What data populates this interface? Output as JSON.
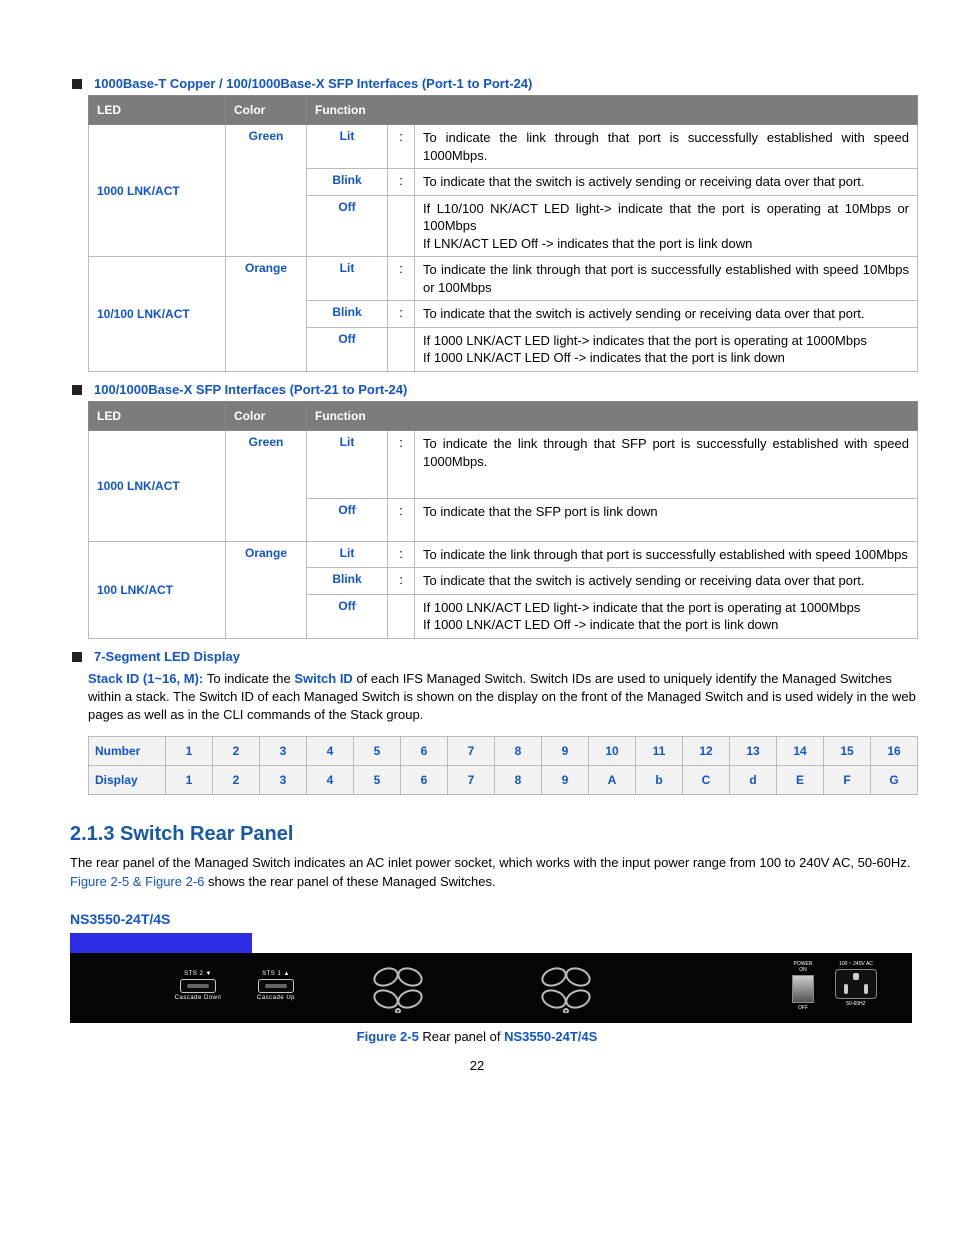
{
  "sections": {
    "led_ports": {
      "bullet": "1000Base-T Copper / 100/1000Base-X SFP Interfaces (Port-1 to Port-24)",
      "header": {
        "c1": "LED",
        "c2": "Color",
        "c3": "Function"
      },
      "row1": {
        "label": "1000 LNK/ACT",
        "color": "Green",
        "r": [
          {
            "state": "Lit",
            "fn": "To indicate the link through that port is successfully established with speed 1000Mbps."
          },
          {
            "state": "Blink",
            "fn": "To indicate that the switch is actively sending or receiving data over that port."
          },
          {
            "state": "Off",
            "fn": "If L10/100 NK/ACT LED light-> indicate that the port is operating at 10Mbps or 100Mbps\nIf LNK/ACT LED Off -> indicates that the port is link down"
          }
        ]
      },
      "row2": {
        "label": "10/100 LNK/ACT",
        "color": "Orange",
        "r": [
          {
            "state": "Lit",
            "fn": "To indicate the link through that port is successfully established with speed 10Mbps or 100Mbps"
          },
          {
            "state": "Blink",
            "fn": "To indicate that the switch is actively sending or receiving data over that port."
          },
          {
            "state": "Off",
            "fn": "If 1000 LNK/ACT LED light-> indicates that the port is operating at 1000Mbps\nIf 1000 LNK/ACT LED Off -> indicates that the port is link down"
          }
        ]
      }
    },
    "led_sfp": {
      "bullet": "100/1000Base-X SFP Interfaces (Port-21 to Port-24)",
      "header": {
        "c1": "LED",
        "c2": "Color",
        "c3": "Function"
      },
      "row1": {
        "label": "1000 LNK/ACT",
        "color": "Green",
        "r": [
          {
            "state": "Lit",
            "fn": "To indicate the link through that SFP port is successfully established with speed 1000Mbps."
          },
          {
            "state": "Off",
            "fn": "To indicate that the SFP port is link down"
          }
        ]
      },
      "row2": {
        "label": "100 LNK/ACT",
        "color": "Orange",
        "r": [
          {
            "state": "Lit",
            "fn": "To indicate the link through that port is successfully established with speed 100Mbps"
          },
          {
            "state": "Blink",
            "fn": "To indicate that the switch is actively sending or receiving data over that port."
          },
          {
            "state": "Off",
            "fn": "If 1000 LNK/ACT LED light-> indicate that the port is operating at 1000Mbps\nIf 1000 LNK/ACT LED Off -> indicate that the port is link down"
          }
        ]
      }
    },
    "stack": {
      "bullet": "7-Segment LED Display",
      "desc": {
        "l1a": "Stack ID (1~16, M): ",
        "l1b": "To indicate the ",
        "l1c": "Switch ID",
        "l1d": " of each IFS Managed Switch. Switch IDs are used to uniquely identify the Managed Switches within a stack. The Switch ID of each Managed Switch is shown on the display on the front of the Managed Switch and is used widely in the web pages as well as in the CLI commands of the Stack group."
      },
      "table": {
        "hdr1": "Number",
        "hdr2": "Display",
        "nums": [
          "1",
          "2",
          "3",
          "4",
          "5",
          "6",
          "7",
          "8",
          "9",
          "10",
          "11",
          "12",
          "13",
          "14",
          "15",
          "16"
        ],
        "disp": [
          "1",
          "2",
          "3",
          "4",
          "5",
          "6",
          "7",
          "8",
          "9",
          "A",
          "b",
          "C",
          "d",
          "E",
          "F",
          "G"
        ]
      }
    },
    "rear": {
      "heading": "2.1.3 Switch Rear Panel",
      "para1a": "The rear panel of the Managed Switch indicates an AC inlet power socket, which works with the input power range from 100 to 240V AC, 50-60Hz. ",
      "figref": "Figure 2-5 & Figure 2-6",
      "para1b": " shows the rear panel of these Managed Switches.",
      "model": "NS3550-24T/4S",
      "sts1_top": "STS 2 ▼",
      "sts1_bot": "Cascade Down",
      "sts2_top": "STS 1 ▲",
      "sts2_bot": "Cascade Up",
      "pwr_top": "POWER",
      "pwr_on": "ON",
      "pwr_off": "OFF",
      "ac_top": "100 ~ 240V AC",
      "ac_bot": "50-60HZ",
      "figcap_a": "Figure 2-5 ",
      "figcap_b": "Rear panel of ",
      "figcap_c": "NS3550-24T/4S"
    },
    "page": "22"
  }
}
